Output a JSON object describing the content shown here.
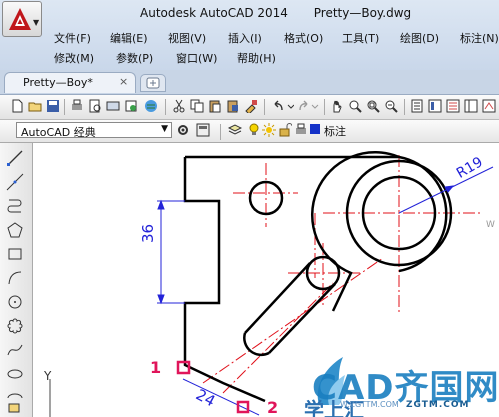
{
  "window": {
    "app_name": "Autodesk AutoCAD 2014",
    "file_name": "Pretty—Boy.dwg"
  },
  "menu": {
    "row1": [
      "文件(F)",
      "编辑(E)",
      "视图(V)",
      "插入(I)",
      "格式(O)",
      "工具(T)",
      "绘图(D)",
      "标注(N)"
    ],
    "row2": [
      "修改(M)",
      "参数(P)",
      "窗口(W)",
      "帮助(H)"
    ]
  },
  "tabs": {
    "active": "Pretty—Boy*",
    "close_glyph": "×"
  },
  "toolbar2": {
    "workspace": "AutoCAD 经典",
    "layer_name": "标注"
  },
  "drawing": {
    "dimension_36": "36",
    "dimension_24": "24",
    "dimension_r19": "R19",
    "ucs_axis_y": "Y",
    "marker_1": "1",
    "marker_2": "2",
    "edge_fragment": "W"
  },
  "watermark": {
    "brand": "CAD齐国网",
    "sub": "学上汇",
    "url": "ZGTM.COM",
    "url2": "W.ZGTTM.COM"
  },
  "colors": {
    "dimension": "#2323d8",
    "centerline": "#e0101a",
    "outline": "#000000",
    "marker": "#e0155a",
    "layer_swatch": "#1432c8"
  }
}
